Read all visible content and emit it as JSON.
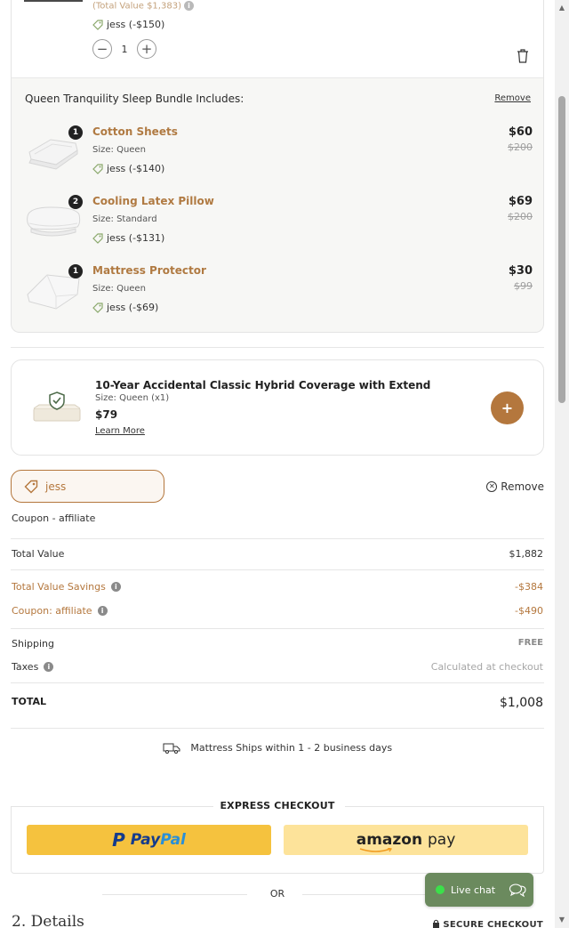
{
  "top_item": {
    "total_value_text": "(Total Value $1,383)",
    "coupon_tag": "jess (-$150)",
    "quantity": "1"
  },
  "bundle": {
    "title": "Queen Tranquility Sleep Bundle Includes:",
    "remove_label": "Remove",
    "items": [
      {
        "badge": "1",
        "name": "Cotton Sheets",
        "size": "Size: Queen",
        "coupon": "jess (-$140)",
        "price": "$60",
        "original": "$200"
      },
      {
        "badge": "2",
        "name": "Cooling Latex Pillow",
        "size": "Size: Standard",
        "coupon": "jess (-$131)",
        "price": "$69",
        "original": "$200"
      },
      {
        "badge": "1",
        "name": "Mattress Protector",
        "size": "Size: Queen",
        "coupon": "jess (-$69)",
        "price": "$30",
        "original": "$99"
      }
    ]
  },
  "extend": {
    "title": "10-Year Accidental Classic Hybrid Coverage with Extend",
    "size": "Size: Queen (x1)",
    "price": "$79",
    "learn_more": "Learn More",
    "add_symbol": "+"
  },
  "coupon": {
    "code": "jess",
    "remove_label": "Remove",
    "label": "Coupon - affiliate"
  },
  "summary": {
    "total_value_label": "Total Value",
    "total_value": "$1,882",
    "savings_label": "Total Value Savings",
    "savings": "-$384",
    "coupon_label": "Coupon: affiliate",
    "coupon_amount": "-$490",
    "shipping_label": "Shipping",
    "shipping": "FREE",
    "taxes_label": "Taxes",
    "taxes": "Calculated at checkout",
    "total_label": "TOTAL",
    "total": "$1,008"
  },
  "shipping_note": "Mattress Ships within 1 - 2 business days",
  "express": {
    "title": "EXPRESS CHECKOUT",
    "paypal_pay": "Pay",
    "paypal_pal": "Pal",
    "amazon_word": "amazon",
    "amazon_pay": "pay"
  },
  "or_label": "OR",
  "details_heading": "2. Details",
  "secure_checkout": "SECURE CHECKOUT",
  "live_chat": "Live chat",
  "colors": {
    "accent": "#b4773d",
    "paypal_yellow": "#f5c23e",
    "amazon_yellow": "#fde39a",
    "live_chat_green": "#6b8a5e"
  }
}
